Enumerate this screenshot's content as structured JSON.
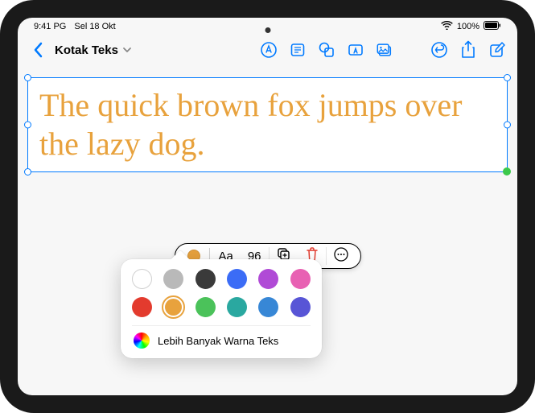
{
  "status": {
    "time": "9:41 PG",
    "date": "Sel 18 Okt",
    "battery": "100%"
  },
  "header": {
    "title": "Kotak Teks"
  },
  "textbox": {
    "content": "The quick brown fox jumps over the lazy dog.",
    "color": "#e8a23d"
  },
  "format_bar": {
    "font_label": "Aa",
    "font_size": "96"
  },
  "color_palette": {
    "swatches": [
      "#ffffff",
      "#b9b9b9",
      "#3a3a3a",
      "#3b6cf6",
      "#b04ad6",
      "#e861b3",
      "#e33b2e",
      "#e8a23d",
      "#4bc25a",
      "#2aa8a0",
      "#3787d6",
      "#5855d6"
    ],
    "selected_index": 7,
    "more_label": "Lebih Banyak Warna Teks"
  }
}
